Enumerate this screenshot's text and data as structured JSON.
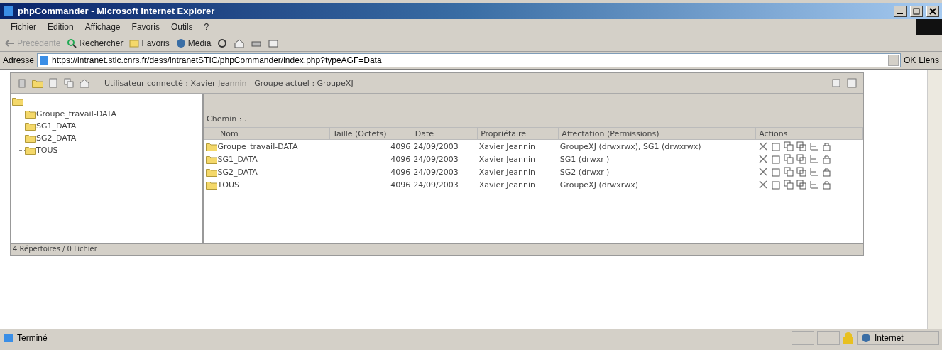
{
  "window": {
    "title": "phpCommander - Microsoft Internet Explorer"
  },
  "menu": [
    "Fichier",
    "Edition",
    "Affichage",
    "Favoris",
    "Outils",
    "?"
  ],
  "toolbar": [
    {
      "label": "Précédente",
      "disabled": true
    },
    {
      "label": "Rechercher",
      "disabled": false
    },
    {
      "label": "Favoris",
      "disabled": false
    },
    {
      "label": "Média",
      "disabled": false
    }
  ],
  "address": {
    "label": "Adresse",
    "value": "https://intranet.stic.cnrs.fr/dess/intranetSTIC/phpCommander/index.php?typeAGF=Data",
    "go": "OK",
    "links": "Liens"
  },
  "app": {
    "user_info": "Utilisateur connecté : Xavier Jeannin   Groupe actuel : GroupeXJ",
    "tree": {
      "children": [
        {
          "name": "Groupe_travail-DATA"
        },
        {
          "name": "SG1_DATA"
        },
        {
          "name": "SG2_DATA"
        },
        {
          "name": "TOUS"
        }
      ]
    },
    "path": "Chemin : .",
    "table": {
      "columns": [
        "Nom",
        "Taille (Octets)",
        "Date",
        "Propriétaire",
        "Affectation (Permissions)",
        "Actions"
      ],
      "rows": [
        {
          "name": "Groupe_travail-DATA",
          "size": "4096",
          "date": "24/09/2003",
          "owner": "Xavier Jeannin",
          "perm": "GroupeXJ (drwxrwx), SG1 (drwxrwx)"
        },
        {
          "name": "SG1_DATA",
          "size": "4096",
          "date": "24/09/2003",
          "owner": "Xavier Jeannin",
          "perm": "SG1 (drwxr-)"
        },
        {
          "name": "SG2_DATA",
          "size": "4096",
          "date": "24/09/2003",
          "owner": "Xavier Jeannin",
          "perm": "SG2 (drwxr-)"
        },
        {
          "name": "TOUS",
          "size": "4096",
          "date": "24/09/2003",
          "owner": "Xavier Jeannin",
          "perm": "GroupeXJ (drwxrwx)"
        }
      ]
    },
    "summary": "4 Répertoires / 0 Fichier"
  },
  "status_bar": {
    "text": "Terminé",
    "zone": "Internet"
  }
}
